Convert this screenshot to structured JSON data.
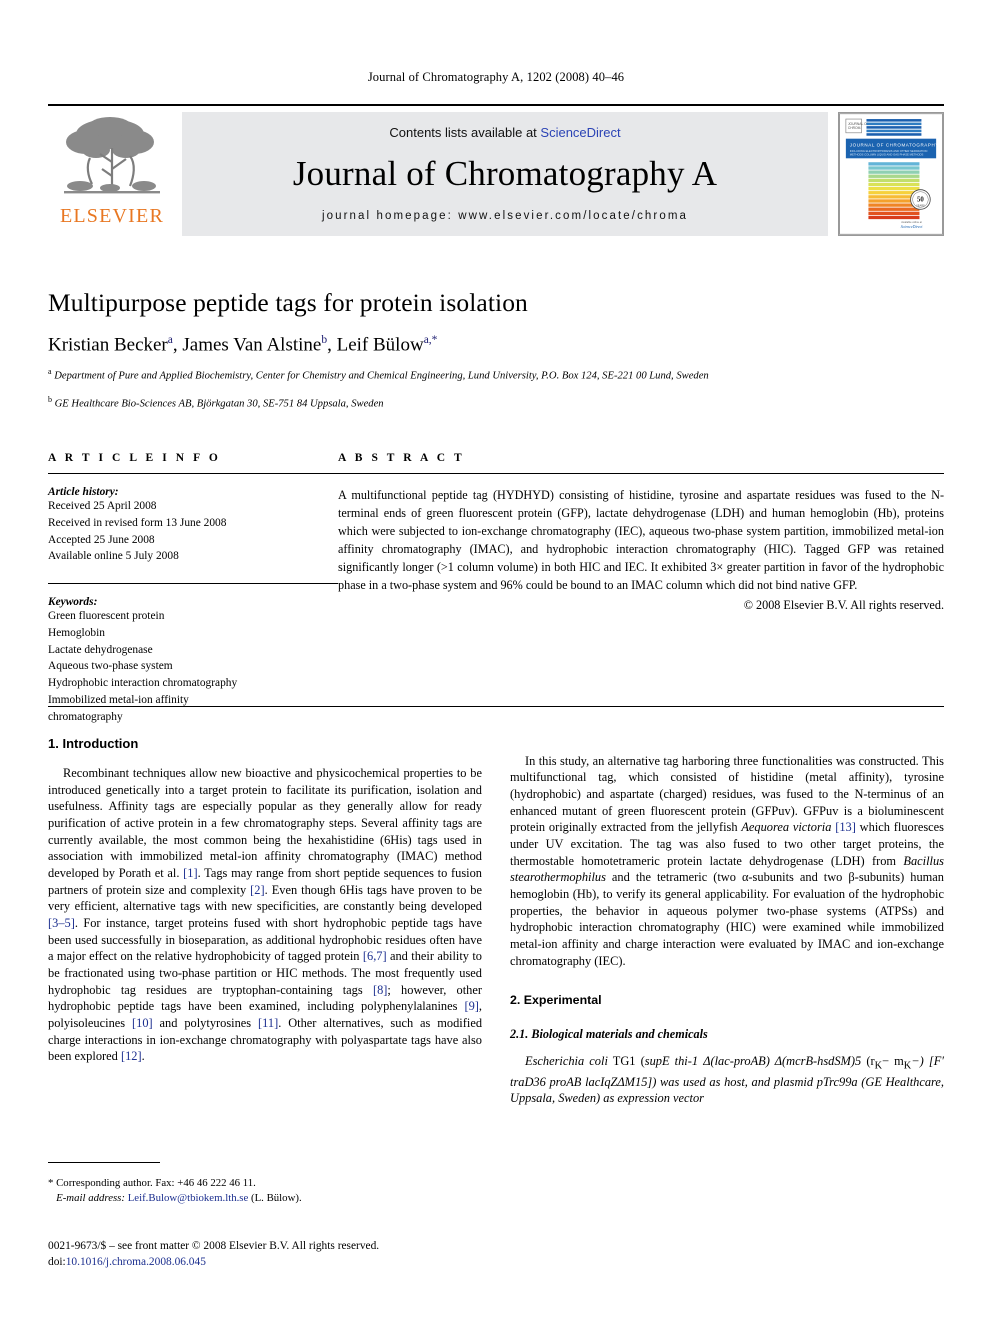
{
  "running_head": "Journal of Chromatography A, 1202 (2008) 40–46",
  "masthead": {
    "publisher_name": "ELSEVIER",
    "contents_prefix": "Contents lists available at ",
    "contents_link": "ScienceDirect",
    "journal_name": "Journal of Chromatography A",
    "homepage": "journal homepage: www.elsevier.com/locate/chroma",
    "cover": {
      "journal_title": "JOURNAL OF CHROMATOGRAPHY A",
      "subtitle": "INCLUDING ELECTROPHORESIS AND OTHER SEPARATION METHODS COLUMN LIQUID AND GAS PHASE METHODS",
      "seal_number": "50",
      "seal_label": "YEARS",
      "imprint_label": "Available online at",
      "imprint_name": "ScienceDirect",
      "band_color": "#1b63b0",
      "stripe_colors": [
        "#1b5fae",
        "#2f7dc2",
        "#4b9ad1",
        "#63b4d8",
        "#79c6cf",
        "#8fd0b2",
        "#a8d88c",
        "#c2de6b",
        "#d9e257",
        "#ecdf45",
        "#f6d13c",
        "#f7bb34",
        "#f4a12c",
        "#ef8526",
        "#e96a22",
        "#e2521f",
        "#d83c1c"
      ]
    }
  },
  "article": {
    "title": "Multipurpose peptide tags for protein isolation",
    "authors": [
      {
        "name": "Kristian Becker",
        "sup": "a"
      },
      {
        "name": "James Van Alstine",
        "sup": "b"
      },
      {
        "name": "Leif Bülow",
        "sup": "a,*"
      }
    ],
    "affiliations": [
      {
        "sup": "a",
        "text": "Department of Pure and Applied Biochemistry, Center for Chemistry and Chemical Engineering, Lund University, P.O. Box 124, SE-221 00 Lund, Sweden"
      },
      {
        "sup": "b",
        "text": "GE Healthcare Bio-Sciences AB, Björkgatan 30, SE-751 84 Uppsala, Sweden"
      }
    ]
  },
  "article_info": {
    "heading": "A R T I C L E   I N F O",
    "history_label": "Article history:",
    "history": [
      "Received 25 April 2008",
      "Received in revised form 13 June 2008",
      "Accepted 25 June 2008",
      "Available online 5 July 2008"
    ],
    "keywords_label": "Keywords:",
    "keywords": [
      "Green fluorescent protein",
      "Hemoglobin",
      "Lactate dehydrogenase",
      "Aqueous two-phase system",
      "Hydrophobic interaction chromatography",
      "Immobilized metal-ion affinity",
      "chromatography"
    ]
  },
  "abstract": {
    "heading": "A B S T R A C T",
    "text": "A multifunctional peptide tag (HYDHYD) consisting of histidine, tyrosine and aspartate residues was fused to the N-terminal ends of green fluorescent protein (GFP), lactate dehydrogenase (LDH) and human hemoglobin (Hb), proteins which were subjected to ion-exchange chromatography (IEC), aqueous two-phase system partition, immobilized metal-ion affinity chromatography (IMAC), and hydrophobic interaction chromatography (HIC). Tagged GFP was retained significantly longer (>1 column volume) in both HIC and IEC. It exhibited 3× greater partition in favor of the hydrophobic phase in a two-phase system and 96% could be bound to an IMAC column which did not bind native GFP.",
    "copyright": "© 2008 Elsevier B.V. All rights reserved."
  },
  "body": {
    "intro_heading": "1.  Introduction",
    "intro_p1_a": "Recombinant techniques allow new bioactive and physicochemical properties to be introduced genetically into a target protein to facilitate its purification, isolation and usefulness. Affinity tags are especially popular as they generally allow for ready purification of active protein in a few chromatography steps. Several affinity tags are currently available, the most common being the hexahistidine (6His) tags used in association with immobilized metal-ion affinity chromatography (IMAC) method developed by Porath et al. ",
    "cite1": "[1]",
    "intro_p1_b": ". Tags may range from short peptide sequences to fusion partners of protein size and complexity ",
    "cite2": "[2]",
    "intro_p1_c": ". Even though 6His tags have proven to be very efficient, alternative tags with new specificities, are constantly being developed ",
    "cite3_5": "[3–5]",
    "intro_p1_d": ". For instance, target proteins fused with short hydrophobic peptide tags have been used successfully in bioseparation, as additional hydrophobic residues often have a major effect on the relative hydrophobicity of tagged protein ",
    "cite6_7": "[6,7]",
    "intro_p1_e": " and their ability to be fractionated using two-phase partition or HIC methods. The most frequently used hydrophobic tag residues are tryptophan-containing tags ",
    "cite8": "[8]",
    "intro_p1_f": "; however, other hydrophobic peptide tags have been examined, including polyphenylalanines ",
    "cite9": "[9]",
    "intro_p1_g": ", polyisoleucines ",
    "cite10": "[10]",
    "intro_p1_h": " and polytyrosines ",
    "cite11": "[11]",
    "intro_p1_i": ". Other alternatives, such as modified charge interactions in ion-exchange chromatography with polyaspartate tags have also been explored ",
    "cite12": "[12]",
    "intro_p1_j": ".",
    "intro_p2_a": "In this study, an alternative tag harboring three functionalities was constructed. This multifunctional tag, which consisted of histidine (metal affinity), tyrosine (hydrophobic) and aspartate (charged) residues, was fused to the N-terminus of an enhanced mutant of green fluorescent protein (GFPuv). GFPuv is a bioluminescent protein originally extracted from the jellyfish ",
    "species1": "Aequorea victoria",
    "intro_p2_b": " ",
    "cite13": "[13]",
    "intro_p2_c": " which fluoresces under UV excitation. The tag was also fused to two other target proteins, the thermostable homotetrameric protein lactate dehydrogenase (LDH) from ",
    "species2": "Bacillus stearothermophilus",
    "intro_p2_d": " and the tetrameric (two α-subunits and two β-subunits) human hemoglobin (Hb), to verify its general applicability. For evaluation of the hydrophobic properties, the behavior in aqueous polymer two-phase systems (ATPSs) and hydrophobic interaction chromatography (HIC) were examined while immobilized metal-ion affinity and charge interaction were evaluated by IMAC and ion-exchange chromatography (IEC).",
    "exp_heading": "2.  Experimental",
    "sub_heading": "2.1.  Biological materials and chemicals",
    "exp_p1_a": "Escherichia coli",
    "exp_p1_b": " TG1 (",
    "exp_p1_c": "supE",
    "exp_p1_d": " thi-1 ",
    "exp_p1_e": "Δ(lac-proAB) Δ(mcrB-hsdSM)5",
    "exp_p1_f": " (r",
    "exp_p1_g": "K",
    "exp_p1_h": "− m",
    "exp_p1_i": "K",
    "exp_p1_j": "−) [F′ traD36 proAB lacIqZΔM15]) was used as host, and plasmid pTrc99a (GE Healthcare, Uppsala, Sweden) as expression vector"
  },
  "footer": {
    "corresponding": "* Corresponding author. Fax: +46 46 222 46 11.",
    "email_label": "E-mail address:",
    "email": "Leif.Bulow@tbiokem.lth.se",
    "email_suffix": " (L. Bülow).",
    "issn_line": "0021-9673/$ – see front matter © 2008 Elsevier B.V. All rights reserved.",
    "doi_label": "doi:",
    "doi": "10.1016/j.chroma.2008.06.045"
  }
}
